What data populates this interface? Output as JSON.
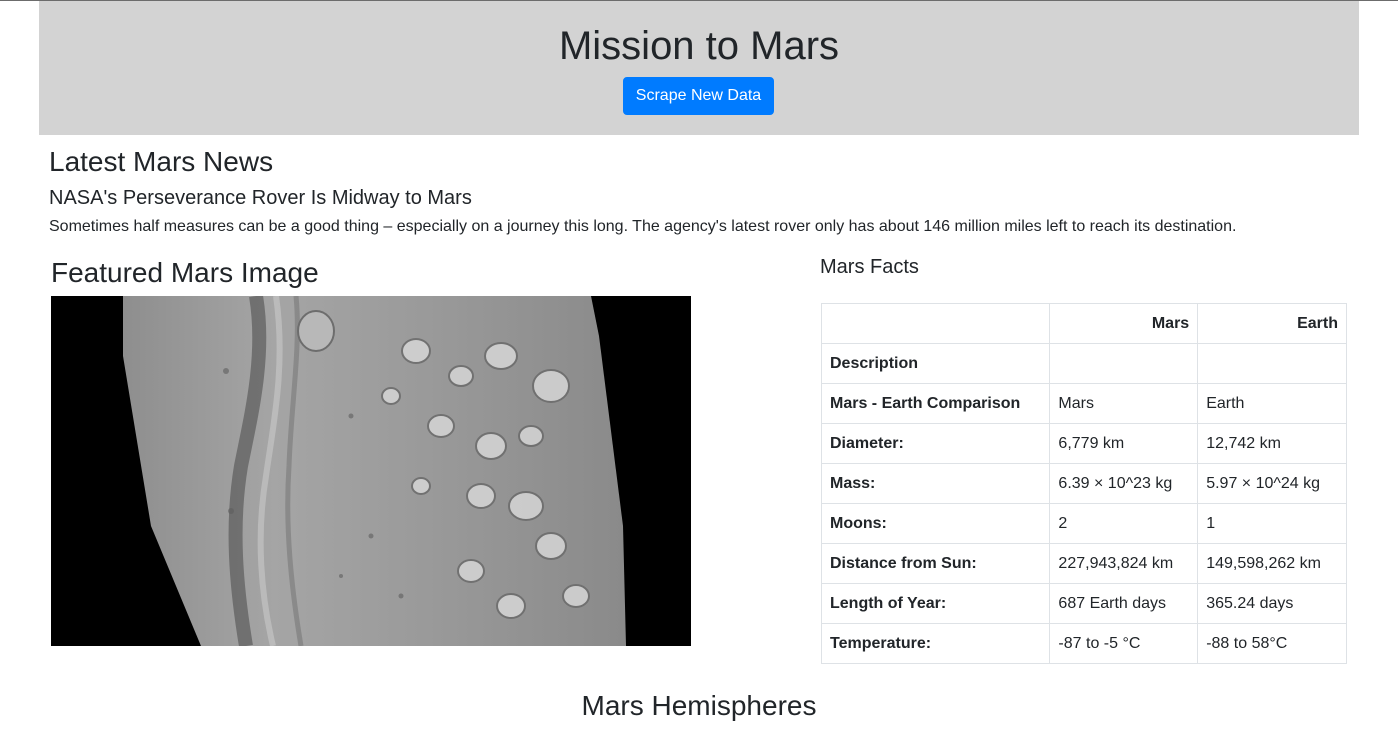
{
  "header": {
    "title": "Mission to Mars",
    "scrape_button": "Scrape New Data"
  },
  "news": {
    "heading": "Latest Mars News",
    "title": "NASA's Perseverance Rover Is Midway to Mars",
    "paragraph": "Sometimes half measures can be a good thing – especially on a journey this long. The agency's latest rover only has about 146 million miles left to reach its destination."
  },
  "featured_image": {
    "heading": "Featured Mars Image"
  },
  "facts": {
    "heading": "Mars Facts",
    "columns": [
      "",
      "Mars",
      "Earth"
    ],
    "rows": [
      {
        "label": "Description",
        "mars": "",
        "earth": ""
      },
      {
        "label": "Mars - Earth Comparison",
        "mars": "Mars",
        "earth": "Earth"
      },
      {
        "label": "Diameter:",
        "mars": "6,779 km",
        "earth": "12,742 km"
      },
      {
        "label": "Mass:",
        "mars": "6.39 × 10^23 kg",
        "earth": "5.97 × 10^24 kg"
      },
      {
        "label": "Moons:",
        "mars": "2",
        "earth": "1"
      },
      {
        "label": "Distance from Sun:",
        "mars": "227,943,824 km",
        "earth": "149,598,262 km"
      },
      {
        "label": "Length of Year:",
        "mars": "687 Earth days",
        "earth": "365.24 days"
      },
      {
        "label": "Temperature:",
        "mars": "-87 to -5 °C",
        "earth": "-88 to 58°C"
      }
    ]
  },
  "hemispheres": {
    "heading": "Mars Hemispheres"
  }
}
